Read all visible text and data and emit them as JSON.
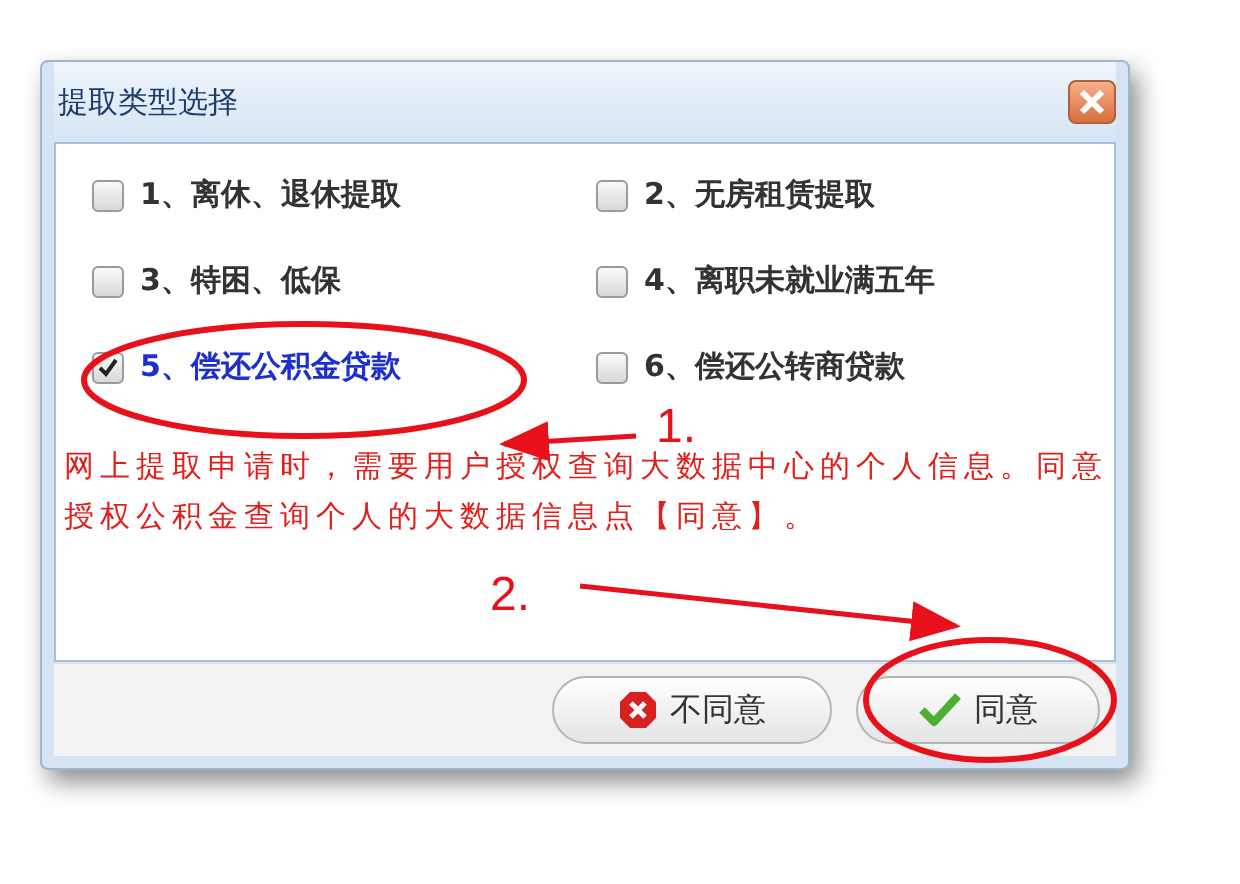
{
  "window": {
    "title": "提取类型选择"
  },
  "options": [
    {
      "label": "1、离休、退休提取",
      "checked": false
    },
    {
      "label": "2、无房租赁提取",
      "checked": false
    },
    {
      "label": "3、特困、低保",
      "checked": false
    },
    {
      "label": "4、离职未就业满五年",
      "checked": false
    },
    {
      "label": "5、偿还公积金贷款",
      "checked": true
    },
    {
      "label": "6、偿还公转商贷款",
      "checked": false
    }
  ],
  "notice": "网上提取申请时，需要用户授权查询大数据中心的个人信息。同意授权公积金查询个人的大数据信息点【同意】。",
  "buttons": [
    {
      "label": "不同意",
      "kind": "cancel"
    },
    {
      "label": "同意",
      "kind": "confirm"
    }
  ],
  "annotations": [
    {
      "label": "1."
    },
    {
      "label": "2."
    }
  ]
}
